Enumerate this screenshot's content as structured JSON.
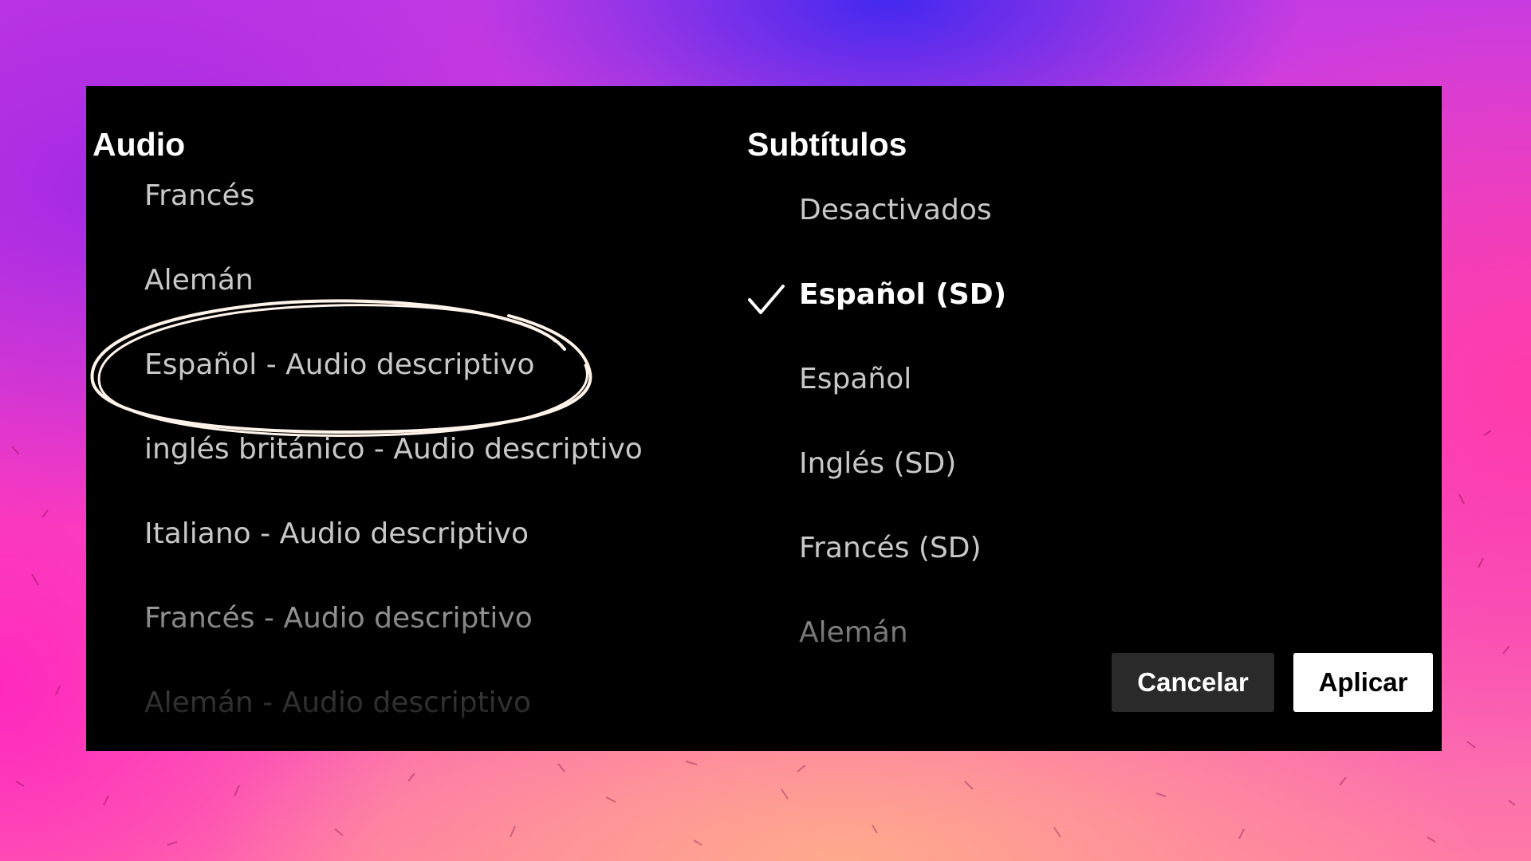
{
  "audio": {
    "heading": "Audio",
    "options": [
      {
        "label": "Francés"
      },
      {
        "label": "Alemán"
      },
      {
        "label": "Español - Audio descriptivo"
      },
      {
        "label": "inglés británico - Audio descriptivo"
      },
      {
        "label": "Italiano - Audio descriptivo"
      },
      {
        "label": "Francés - Audio descriptivo"
      },
      {
        "label": "Alemán - Audio descriptivo"
      }
    ]
  },
  "subtitles": {
    "heading": "Subtítulos",
    "selected_label": "Español (SD)",
    "options": [
      {
        "label": "Desactivados"
      },
      {
        "label": "Español (SD)"
      },
      {
        "label": "Español"
      },
      {
        "label": "Inglés (SD)"
      },
      {
        "label": "Francés (SD)"
      },
      {
        "label": "Alemán"
      }
    ]
  },
  "buttons": {
    "cancel": "Cancelar",
    "apply": "Aplicar"
  },
  "icons": {
    "selected": "checkmark-icon",
    "annotation": "hand-drawn-circle-annotation"
  },
  "colors": {
    "panel_background": "#000000",
    "selected_text": "#ffffff",
    "option_text": "#c8c8c8",
    "cancel_button": "#2a2a2a",
    "apply_button": "#ffffff",
    "annotation_stroke": "#fff3ea"
  }
}
